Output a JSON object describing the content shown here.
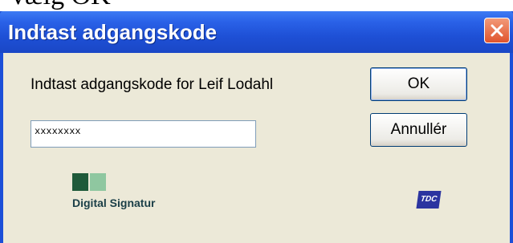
{
  "background_text": "vælg OK",
  "dialog": {
    "title": "Indtast adgangskode",
    "prompt": "Indtast adgangskode for Leif Lodahl",
    "password_value": "xxxxxxxx",
    "ok_label": "OK",
    "cancel_label": "Annullér",
    "logo_left_text": "Digital Signatur",
    "logo_right_text": "TDC"
  },
  "colors": {
    "titlebar": "#1e50d6",
    "dialog_body": "#ece9d8",
    "close_button": "#e0542d",
    "ds_dark_green": "#1f5a3a",
    "ds_light_green": "#8fc7a0",
    "tdc_blue": "#2b34a0"
  },
  "icons": {
    "close": "close-icon",
    "digital_signatur": "digital-signatur-logo",
    "tdc": "tdc-logo"
  }
}
